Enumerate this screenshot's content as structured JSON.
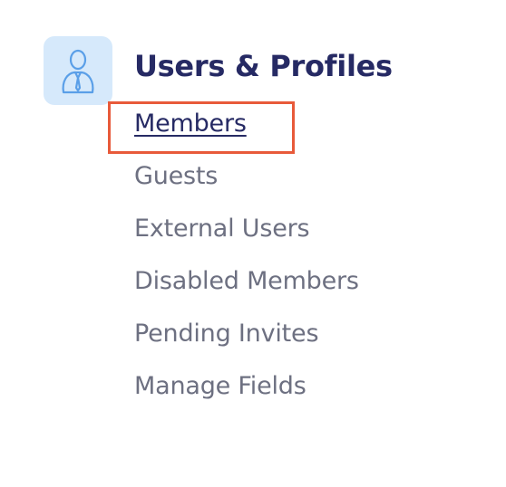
{
  "section": {
    "icon": "user-profile-icon",
    "title": "Users & Profiles"
  },
  "nav": {
    "items": [
      {
        "label": "Members",
        "active": true
      },
      {
        "label": "Guests",
        "active": false
      },
      {
        "label": "External Users",
        "active": false
      },
      {
        "label": "Disabled Members",
        "active": false
      },
      {
        "label": "Pending Invites",
        "active": false
      },
      {
        "label": "Manage Fields",
        "active": false
      }
    ]
  },
  "colors": {
    "title": "#262a64",
    "nav_text": "#6d7081",
    "icon_bg": "#d6e9fb",
    "icon_stroke": "#5a9fe8",
    "highlight": "#e85a3a"
  }
}
